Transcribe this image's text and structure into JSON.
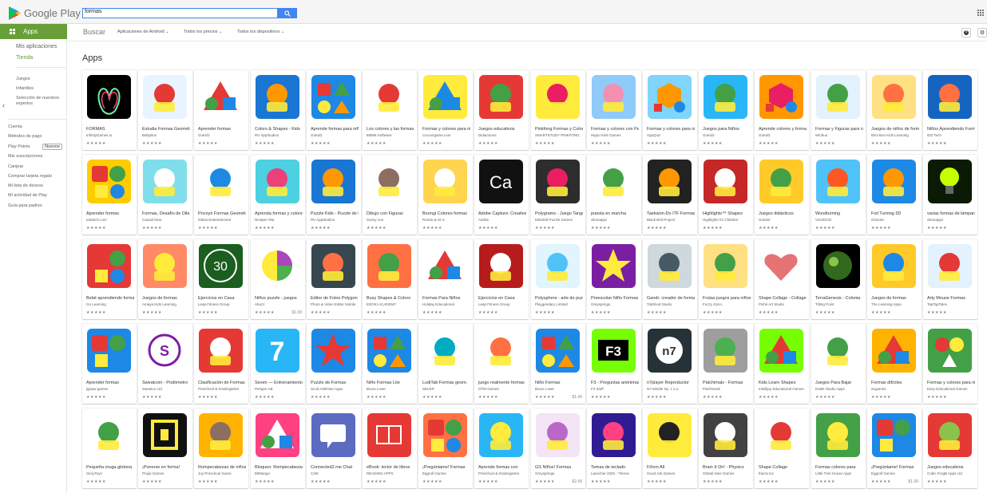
{
  "header": {
    "logo_text": "Google Play",
    "search_value": "formas"
  },
  "sidebar": {
    "apps_label": "Apps",
    "mis_aplicaciones": "Mis aplicaciones",
    "tienda": "Tienda",
    "juegos": "Juegos",
    "infantiles": "Infantiles",
    "seleccion": "Selección de nuestros expertos",
    "cuenta": "Cuenta",
    "metodos": "Métodos de pago",
    "play_points": "Play Points",
    "nuevos_badge": "Nuevos",
    "suscripciones": "Mis suscripciones",
    "canjear": "Canjear",
    "comprar_tarjeta": "Comprar tarjeta regalo",
    "lista_deseos": "Mi lista de deseos",
    "actividad": "Mi actividad de Play",
    "guia_padres": "Guía para padres"
  },
  "subnav": {
    "buscar": "Buscar",
    "filter_category": "Aplicaciones de Android",
    "filter_price": "Todos los precios",
    "filter_devices": "Todos los dispositivos"
  },
  "section_title": "Apps",
  "apps": [
    {
      "title": "FORMAS",
      "dev": "InfinityGames.io",
      "price": "",
      "bg": "#000000",
      "fg": "#6ff0a0",
      "shape": "loop"
    },
    {
      "title": "Estudia Formas Geométricas",
      "dev": "BabyBus",
      "price": "",
      "bg": "#e8f4ff",
      "fg": "#e53935",
      "shape": "panda"
    },
    {
      "title": "Aprender formas",
      "dev": "GoKidz",
      "price": "",
      "bg": "#ffffff",
      "fg": "#e53935",
      "shape": "tri"
    },
    {
      "title": "Colors & Shapes - Kids",
      "dev": "RV AppStudios",
      "price": "",
      "bg": "#1976d2",
      "fg": "#ff9800",
      "shape": "bear"
    },
    {
      "title": "Aprende formas para niños",
      "dev": "GoKidz",
      "price": "",
      "bg": "#1e88e5",
      "fg": "#43a047",
      "shape": "sq"
    },
    {
      "title": "Los colores y las formas",
      "dev": "88888 Software",
      "price": "",
      "bg": "#ffffff",
      "fg": "#e53935",
      "shape": "splash"
    },
    {
      "title": "Formas y colores para niños",
      "dev": "cocoongame.com",
      "price": "",
      "bg": "#ffeb3b",
      "fg": "#1e88e5",
      "shape": "tri"
    },
    {
      "title": "Juegos educativos",
      "dev": "Didactoons",
      "price": "",
      "bg": "#e53935",
      "fg": "#43a047",
      "shape": "croc"
    },
    {
      "title": "Pinkfong Formas y Colores",
      "dev": "SMARTSTUDY PINKFONG",
      "price": "",
      "bg": "#ffeb3b",
      "fg": "#e91e63",
      "shape": "cat"
    },
    {
      "title": "Formas y colores con Peppa",
      "dev": "Hippo Kids Games",
      "price": "",
      "bg": "#90caf9",
      "fg": "#f48fb1",
      "shape": "pig"
    },
    {
      "title": "Formas y colores para niños",
      "dev": "AppQuiz",
      "price": "",
      "bg": "#81d4fa",
      "fg": "#ff9800",
      "shape": "hex"
    },
    {
      "title": "Juegos para Niños",
      "dev": "GoKidz",
      "price": "",
      "bg": "#29b6f6",
      "fg": "#43a047",
      "shape": "paw"
    },
    {
      "title": "Aprende colores y formas",
      "dev": "GoKidz",
      "price": "",
      "bg": "#ff9800",
      "fg": "#e91e63",
      "shape": "hex"
    },
    {
      "title": "Formas y Figuras para niños",
      "dev": "Winbuu",
      "price": "",
      "bg": "#e3f2fd",
      "fg": "#43a047",
      "shape": "rocket"
    },
    {
      "title": "Juegos de niños de formas",
      "dev": "Bimi Boo Kids Learning",
      "price": "",
      "bg": "#ffe082",
      "fg": "#ff7043",
      "shape": "cat"
    },
    {
      "title": "Niños Aprendiendo Formas",
      "dev": "IDZ Tech",
      "price": "",
      "bg": "#1565c0",
      "fg": "#ff7043",
      "shape": "monkey"
    },
    {
      "title": "Aprender formas",
      "dev": "edutech.com",
      "price": "",
      "bg": "#ffcc00",
      "fg": "#e53935",
      "shape": "faces"
    },
    {
      "title": "Formas, Desafío de Dibujo",
      "dev": "Casual Nine",
      "price": "",
      "bg": "#80deea",
      "fg": "#ffffff",
      "shape": "paper"
    },
    {
      "title": "Pocoyó Formas Geométricas",
      "dev": "Zinkia Entertainment",
      "price": "",
      "bg": "#ffffff",
      "fg": "#1e88e5",
      "shape": "poco"
    },
    {
      "title": "Aprenda formas y colores",
      "dev": "NHaper Alta",
      "price": "",
      "bg": "#4dd0e1",
      "fg": "#ec407a",
      "shape": "blocks"
    },
    {
      "title": "Puzzle Kids - Puzzle de formas",
      "dev": "RV AppStudios",
      "price": "",
      "bg": "#1976d2",
      "fg": "#ff9800",
      "shape": "bear"
    },
    {
      "title": "Dibujo con Figuras",
      "dev": "Sonny Jon",
      "price": "",
      "bg": "#ffffff",
      "fg": "#8d6e63",
      "shape": "palette"
    },
    {
      "title": "Boongi Colores formas",
      "dev": "Rondo & Ali S",
      "price": "",
      "bg": "#ffd54f",
      "fg": "#ffffff",
      "shape": "bunny"
    },
    {
      "title": "Adobe Capture: Creative",
      "dev": "Adobe",
      "price": "",
      "bg": "#111111",
      "fg": "#ffffff",
      "shape": "ca"
    },
    {
      "title": "Polygrams - Juego Tangram",
      "dev": "Mindmill Puzzle Games",
      "price": "",
      "bg": "#2d2d2d",
      "fg": "#e91e63",
      "shape": "gem"
    },
    {
      "title": "puesta en marcha",
      "dev": "vikonappz",
      "price": "",
      "bg": "#ffffff",
      "fg": "#43a047",
      "shape": "coins"
    },
    {
      "title": "Taekwon-Do ITF Formas",
      "dev": "Black Belt Project",
      "price": "",
      "bg": "#222222",
      "fg": "#ff9800",
      "shape": "belt"
    },
    {
      "title": "Highlights™ Shapes",
      "dev": "Highlights for Children",
      "price": "",
      "bg": "#c62828",
      "fg": "#ffffff",
      "shape": "high"
    },
    {
      "title": "Juegos didácticos",
      "dev": "GoKidz",
      "price": "",
      "bg": "#ffca28",
      "fg": "#43a047",
      "shape": "nums"
    },
    {
      "title": "Woodturning",
      "dev": "VOODOO",
      "price": "",
      "bg": "#4fc3f7",
      "fg": "#ff5722",
      "shape": "wood"
    },
    {
      "title": "Foil Turning 3D",
      "dev": "Gismart",
      "price": "",
      "bg": "#1e88e5",
      "fg": "#ff9800",
      "shape": "foil"
    },
    {
      "title": "varias formas de lámpara",
      "dev": "vikonappz",
      "price": "",
      "bg": "#0a1a05",
      "fg": "#c6ff00",
      "shape": "bulb"
    },
    {
      "title": "Bebé aprendiendo formas",
      "dev": "Go Learning",
      "price": "",
      "bg": "#e53935",
      "fg": "#ffeb3b",
      "shape": "faces"
    },
    {
      "title": "Juegos de formas",
      "dev": "Amaya Kids Learning",
      "price": "",
      "bg": "#ff8a65",
      "fg": "#ffeb3b",
      "shape": "lion"
    },
    {
      "title": "Ejercicios en Casa",
      "dev": "Leap Fitness Group",
      "price": "",
      "bg": "#1b5e20",
      "fg": "#ffffff",
      "shape": "thirty"
    },
    {
      "title": "Niños puzzle - juegos",
      "dev": "Abuzz",
      "price": "$1.99",
      "bg": "#ffffff",
      "fg": "#ab47bc",
      "shape": "pie"
    },
    {
      "title": "Editor de Fotos Polygon",
      "dev": "Photo & Video Editor Mobile",
      "price": "",
      "bg": "#37474f",
      "fg": "#ff7043",
      "shape": "poly"
    },
    {
      "title": "Busy Shapes & Colors",
      "dev": "EDOKI ACADEMY",
      "price": "",
      "bg": "#ff7043",
      "fg": "#43a047",
      "shape": "busy"
    },
    {
      "title": "Formas Para Niños",
      "dev": "Holiday Educational",
      "price": "",
      "bg": "#ffffff",
      "fg": "#e53935",
      "shape": "tri"
    },
    {
      "title": "Ejercicios en Casa",
      "dev": "Leap Fitness Group",
      "price": "",
      "bg": "#b71c1c",
      "fg": "#ffffff",
      "shape": "arm"
    },
    {
      "title": "Polysphere - arte de puzzle",
      "dev": "Playgendary Limited",
      "price": "",
      "bg": "#e1f5fe",
      "fg": "#4fc3f7",
      "shape": "whale"
    },
    {
      "title": "Preescolar Niño Formas",
      "dev": "Greysprings",
      "price": "",
      "bg": "#7b1fa2",
      "fg": "#ffeb3b",
      "shape": "star"
    },
    {
      "title": "Gandr: creador de formas",
      "dev": "Tiddmod Studio",
      "price": "",
      "bg": "#cfd8dc",
      "fg": "#455a64",
      "shape": "maze"
    },
    {
      "title": "Frutas juegos para niños",
      "dev": "Fuzzy Zorro",
      "price": "",
      "bg": "#ffe082",
      "fg": "#43a047",
      "shape": "frog"
    },
    {
      "title": "Shape Collage - Collage",
      "dev": "Piché Art Studio",
      "price": "",
      "bg": "#ffffff",
      "fg": "#e57373",
      "shape": "heart"
    },
    {
      "title": "TerraGenesis - Colonia",
      "dev": "Tilting Point",
      "price": "",
      "bg": "#000000",
      "fg": "#8bc34a",
      "shape": "planet"
    },
    {
      "title": "Juegos de formas",
      "dev": "The Learning Apps",
      "price": "",
      "bg": "#ffca28",
      "fg": "#1e88e5",
      "shape": "bus"
    },
    {
      "title": "Arty Mouse Formas",
      "dev": "TapTapTales",
      "price": "",
      "bg": "#e3f2fd",
      "fg": "#e53935",
      "shape": "mouse"
    },
    {
      "title": "Aprender formas",
      "dev": "jigsaw games",
      "price": "",
      "bg": "#1e88e5",
      "fg": "#ffffff",
      "shape": "faces"
    },
    {
      "title": "Sweatcoin - Podómetro",
      "dev": "Sweatco Ltd",
      "price": "",
      "bg": "#ffffff",
      "fg": "#7b1fa2",
      "shape": "sweat"
    },
    {
      "title": "Clasificación de Formas",
      "dev": "Preschool & Kindergarten",
      "price": "",
      "bg": "#e53935",
      "fg": "#ffffff",
      "shape": "tiny"
    },
    {
      "title": "Seven — Entrenamiento",
      "dev": "Perigee AB",
      "price": "",
      "bg": "#29b6f6",
      "fg": "#ffffff",
      "shape": "seven"
    },
    {
      "title": "Puzzle de Formas",
      "dev": "Scott Adelman Apps",
      "price": "",
      "bg": "#1e88e5",
      "fg": "#e53935",
      "shape": "star"
    },
    {
      "title": "Niño Formas Lite",
      "dev": "Bruce Lowe",
      "price": "",
      "bg": "#1e88e5",
      "fg": "#e53935",
      "shape": "sq"
    },
    {
      "title": "LudiTab Formas geom.",
      "dev": "SELER",
      "price": "",
      "bg": "#ffffff",
      "fg": "#00acc1",
      "shape": "nathan"
    },
    {
      "title": "juego realmente formas",
      "dev": "OTM Games",
      "price": "",
      "bg": "#ffffff",
      "fg": "#ff7043",
      "shape": "blocks"
    },
    {
      "title": "Niño Formas",
      "dev": "Bruce Lowe",
      "price": "$1.49",
      "bg": "#1e88e5",
      "fg": "#e53935",
      "shape": "sq"
    },
    {
      "title": "F3 - Preguntas anónimas",
      "dev": "F3 Stuff",
      "price": "",
      "bg": "#76ff03",
      "fg": "#000000",
      "shape": "f3"
    },
    {
      "title": "n7player Reproductor",
      "dev": "N7 Mobile Sp. z o.o.",
      "price": "",
      "bg": "#263238",
      "fg": "#ffffff",
      "shape": "n7"
    },
    {
      "title": "Patchimals - Formas",
      "dev": "Patchimals",
      "price": "",
      "bg": "#9e9e9e",
      "fg": "#4caf50",
      "shape": "patch"
    },
    {
      "title": "Kids Learn Shapes",
      "dev": "Intellijoy Educational Games",
      "price": "",
      "bg": "#76ff03",
      "fg": "#e53935",
      "shape": "tri"
    },
    {
      "title": "Juegos Para Bajar",
      "dev": "Dalek Studio Apps",
      "price": "",
      "bg": "#ffffff",
      "fg": "#43a047",
      "shape": "cups"
    },
    {
      "title": "Formas difíciles",
      "dev": "a1games",
      "price": "",
      "bg": "#ffb300",
      "fg": "#e53935",
      "shape": "tri"
    },
    {
      "title": "Formas y colores para niños",
      "dev": "Easy Educational Games",
      "price": "",
      "bg": "#43a047",
      "fg": "#e53935",
      "shape": "balls"
    },
    {
      "title": "Pequeña oruga glotona",
      "dev": "StoryToys",
      "price": "",
      "bg": "#ffffff",
      "fg": "#43a047",
      "shape": "cater"
    },
    {
      "title": "¡Ponerse en forma!",
      "dev": "Prujia Games",
      "price": "",
      "bg": "#111111",
      "fg": "#ffeb3b",
      "shape": "five"
    },
    {
      "title": "Rompecabezas de niños",
      "dev": "Joy Preschool Game",
      "price": "",
      "bg": "#ffb300",
      "fg": "#8d6e63",
      "shape": "hippo"
    },
    {
      "title": "Bloqueo: Rompecabezas",
      "dev": "BitMango",
      "price": "",
      "bg": "#ff4081",
      "fg": "#ffffff",
      "shape": "tri"
    },
    {
      "title": "Connected2.me Chat",
      "dev": "C2M",
      "price": "",
      "bg": "#5c6bc0",
      "fg": "#ffffff",
      "shape": "chat"
    },
    {
      "title": "eBook: lector de libros",
      "dev": "READING APPS",
      "price": "",
      "bg": "#e53935",
      "fg": "#ffffff",
      "shape": "book"
    },
    {
      "title": "¡Pregúntame! Formas",
      "dev": "Eggroll Games",
      "price": "",
      "bg": "#ff7043",
      "fg": "#ffeb3b",
      "shape": "faces"
    },
    {
      "title": "Aprende formas con",
      "dev": "Preschool & Kindergarten",
      "price": "",
      "bg": "#29b6f6",
      "fg": "#ffeb3b",
      "shape": "bee"
    },
    {
      "title": "GS Niños! Formas",
      "dev": "Greysprings",
      "price": "$2.49",
      "bg": "#f3e5f5",
      "fg": "#ba68c8",
      "shape": "dino"
    },
    {
      "title": "Temas de teclado",
      "dev": "Launcher 2020 - Theme",
      "price": "",
      "bg": "#311b92",
      "fg": "#ff4081",
      "shape": "kbd"
    },
    {
      "title": "Fit'em All",
      "dev": "Good Job Games",
      "price": "",
      "bg": "#ffeb3b",
      "fg": "#222222",
      "shape": "fit"
    },
    {
      "title": "Brain It On! - Physics",
      "dev": "Orbital Nine Games",
      "price": "",
      "bg": "#424242",
      "fg": "#ffffff",
      "shape": "brain"
    },
    {
      "title": "Shape Collage",
      "dev": "Ibarra Inc",
      "price": "",
      "bg": "#ffffff",
      "fg": "#e53935",
      "shape": "name"
    },
    {
      "title": "Formas colores para",
      "dev": "Little Tree House Apps",
      "price": "",
      "bg": "#43a047",
      "fg": "#ffeb3b",
      "shape": "rainbow"
    },
    {
      "title": "¡Pregúntame! Formas",
      "dev": "Eggroll Games",
      "price": "$1.99",
      "bg": "#1e88e5",
      "fg": "#ff7043",
      "shape": "faces"
    },
    {
      "title": "Juegos educativos",
      "dev": "Cubic FrogB Apps Ltd",
      "price": "",
      "bg": "#e53935",
      "fg": "#8bc34a",
      "shape": "frog"
    }
  ]
}
